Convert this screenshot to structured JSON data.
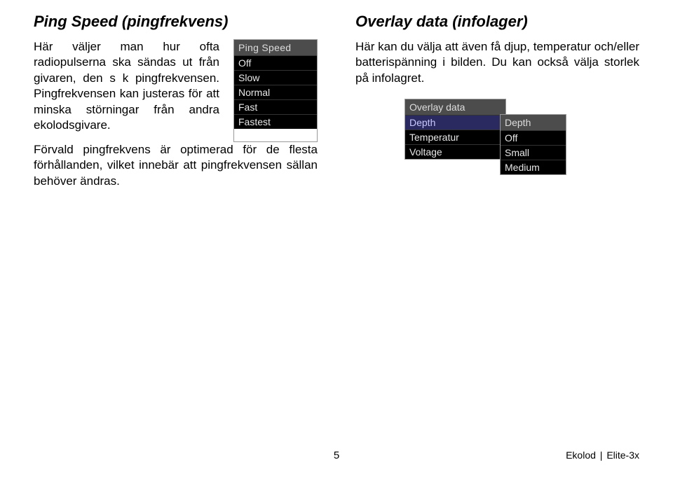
{
  "left": {
    "title": "Ping Speed (pingfrekvens)",
    "p1": "Här väljer man hur ofta radiopulserna ska sändas ut från givaren, den s k pingfrekvensen. Pingfrekvensen kan justeras för att minska störningar från andra ekolodsgivare.",
    "p2": "Förvald pingfrekvens är optimerad för de flesta förhållanden, vilket innebär att pingfrekvensen sällan behöver ändras.",
    "menu": {
      "title": "Ping Speed",
      "items": [
        "Off",
        "Slow",
        "Normal",
        "Fast",
        "Fastest"
      ]
    }
  },
  "right": {
    "title": "Overlay data (infolager)",
    "p1": "Här kan du välja att även få djup, temperatur och/eller batterispänning i bilden. Du kan också välja storlek på infolagret.",
    "overlayMenu": {
      "title": "Overlay data",
      "items": [
        {
          "label": "Depth",
          "highlight": true
        },
        {
          "label": "Temperatur",
          "highlight": false
        },
        {
          "label": "Voltage",
          "highlight": false
        }
      ],
      "sub": {
        "title": "Depth",
        "items": [
          "Off",
          "Small",
          "Medium"
        ]
      }
    }
  },
  "footer": {
    "page": "5",
    "section": "Ekolod",
    "model": "Elite-3x"
  }
}
